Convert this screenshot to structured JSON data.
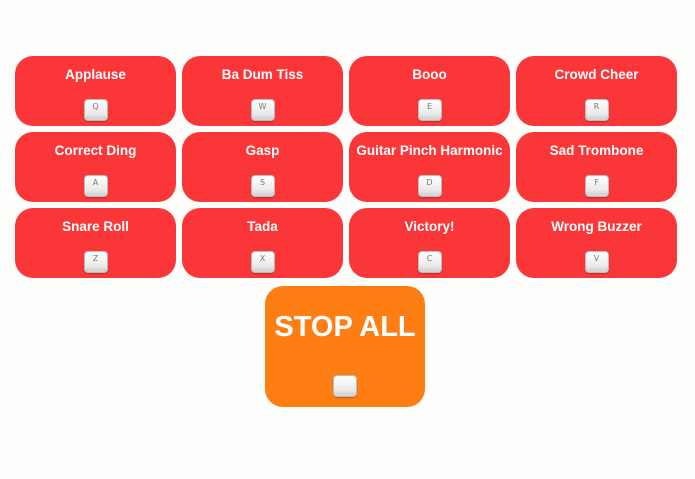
{
  "colors": {
    "sound_button": "#fb3639",
    "stop_button": "#fe7e13",
    "label_text": "#ffffff",
    "background": "#fefefc"
  },
  "sounds": [
    {
      "label": "Applause",
      "key": "Q"
    },
    {
      "label": "Ba Dum Tiss",
      "key": "W"
    },
    {
      "label": "Booo",
      "key": "E"
    },
    {
      "label": "Crowd Cheer",
      "key": "R"
    },
    {
      "label": "Correct Ding",
      "key": "A"
    },
    {
      "label": "Gasp",
      "key": "S"
    },
    {
      "label": "Guitar Pinch Harmonic",
      "key": "D"
    },
    {
      "label": "Sad Trombone",
      "key": "F"
    },
    {
      "label": "Snare Roll",
      "key": "Z"
    },
    {
      "label": "Tada",
      "key": "X"
    },
    {
      "label": "Victory!",
      "key": "C"
    },
    {
      "label": "Wrong Buzzer",
      "key": "V"
    }
  ],
  "stop": {
    "label": "STOP ALL",
    "key": ""
  }
}
